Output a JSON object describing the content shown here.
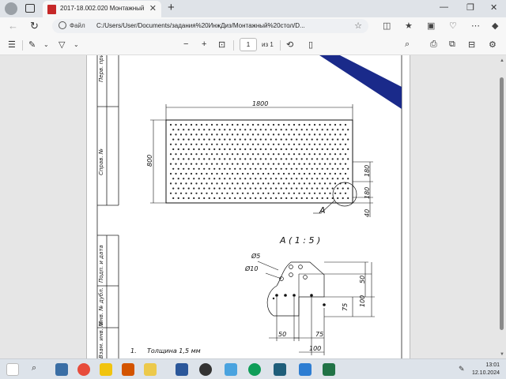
{
  "browser": {
    "tab_title": "2017-18.002.020 Монтажный ш",
    "address_label": "Файл",
    "url": "C:/Users/User/Documents/задания%20ИнжДиз/Монтажный%20стол/D..."
  },
  "pdf_toolbar": {
    "page_number": "1",
    "page_of": "из 1",
    "zoom_out": "−",
    "zoom_in": "+"
  },
  "drawing": {
    "stamp_labels": [
      "Перв. прим.",
      "Справ. №",
      "Подп. и дата",
      "Инв. № дубл.",
      "Взам. инв. №"
    ],
    "dim_width": "1800",
    "dim_height": "800",
    "dim_right_1": "180",
    "dim_right_2": "180",
    "dim_right_3": "40",
    "view_callout": "A",
    "detail_title": "A ( 1 : 5 )",
    "dia_small": "Ø5",
    "dia_large": "Ø10",
    "detail_dim_50_v": "50",
    "detail_dim_100_v": "100",
    "detail_dim_75_v": "75",
    "detail_dim_50_h": "50",
    "detail_dim_75_h": "75",
    "detail_dim_100_h": "100",
    "note_number": "1.",
    "note_text": "Толщина 1,5 мм"
  },
  "taskbar": {
    "time": "13:01",
    "date": "12.10.2024"
  },
  "colors": {
    "accent_blue": "#1a2a8a",
    "pdf_red": "#c62828"
  }
}
